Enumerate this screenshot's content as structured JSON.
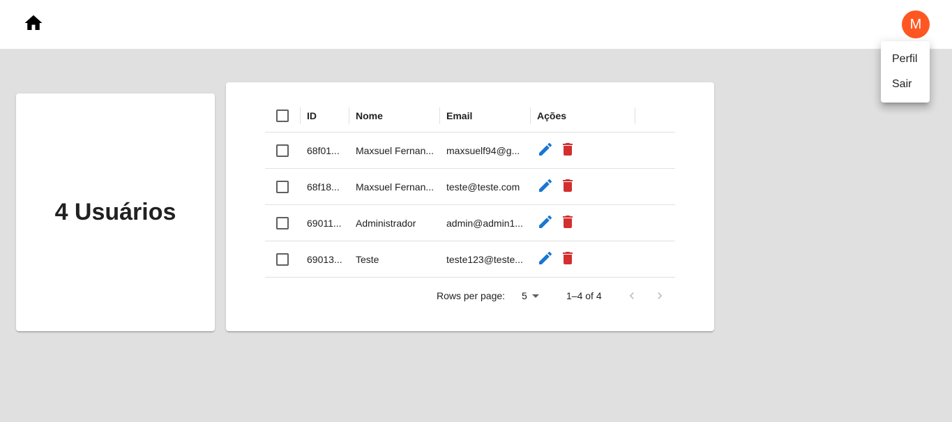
{
  "colors": {
    "avatar_bg": "#ff5722",
    "edit_icon": "#1976d2",
    "delete_icon": "#d32f2f",
    "background": "#e0e0e0"
  },
  "header": {
    "home_icon": "home-icon",
    "avatar_letter": "M"
  },
  "menu": {
    "items": [
      {
        "label": "Perfil"
      },
      {
        "label": "Sair"
      }
    ]
  },
  "summary": {
    "count_text": "4 Usuários"
  },
  "table": {
    "columns": [
      "ID",
      "Nome",
      "Email",
      "Ações"
    ],
    "rows": [
      {
        "id": "68f01...",
        "name": "Maxsuel Fernan...",
        "email": "maxsuelf94@g..."
      },
      {
        "id": "68f18...",
        "name": "Maxsuel Fernan...",
        "email": "teste@teste.com"
      },
      {
        "id": "69011...",
        "name": "Administrador",
        "email": "admin@admin1..."
      },
      {
        "id": "69013...",
        "name": "Teste",
        "email": "teste123@teste..."
      }
    ],
    "footer": {
      "rows_per_page_label": "Rows per page:",
      "rows_per_page_value": "5",
      "range": "1–4 of 4"
    }
  }
}
